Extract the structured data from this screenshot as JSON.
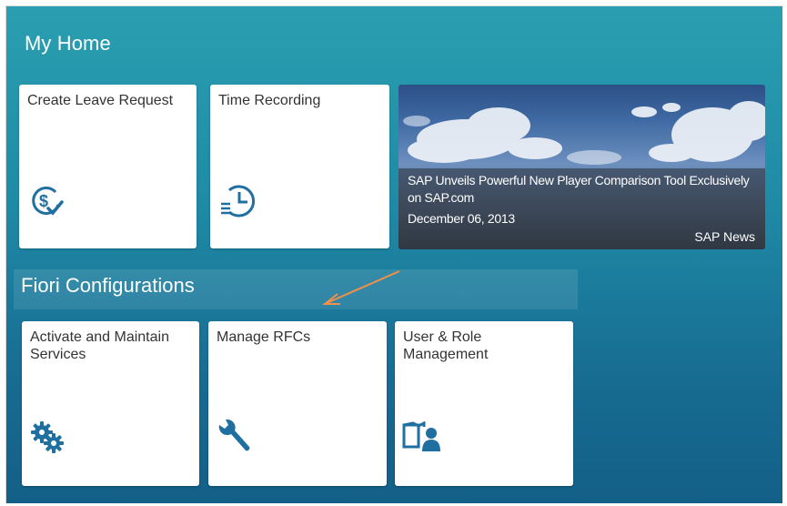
{
  "page": {
    "title": "My Home"
  },
  "tiles_top": [
    {
      "title": "Create Leave Request",
      "icon": "dollar-check-icon"
    },
    {
      "title": "Time Recording",
      "icon": "clock-list-icon"
    }
  ],
  "news_tile": {
    "headline": "SAP Unveils Powerful New Player Comparison Tool Exclusively on SAP.com",
    "date": "December 06, 2013",
    "source": "SAP News"
  },
  "group": {
    "title": "Fiori Configurations",
    "tiles": [
      {
        "title": "Activate and Maintain Services",
        "icon": "gear-icon"
      },
      {
        "title": "Manage RFCs",
        "icon": "wrench-icon"
      },
      {
        "title": "User & Role Management",
        "icon": "book-user-icon"
      }
    ]
  },
  "colors": {
    "background": "#1f8aa6",
    "icon": "#1f6fa0",
    "tile": "#ffffff",
    "annotation_arrow": "#f0904a"
  }
}
